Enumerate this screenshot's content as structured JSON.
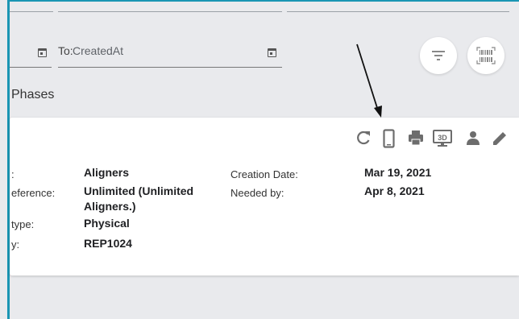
{
  "date_filter": {
    "to_label": "To:",
    "to_value": "CreatedAt"
  },
  "section": {
    "phases_label": "Phases"
  },
  "icons": [
    "calendar-icon",
    "filter-icon",
    "barcode-scan-icon",
    "refresh-icon",
    "mobile-icon",
    "print-icon",
    "3d-view-icon",
    "person-icon",
    "edit-icon",
    "annotation-arrow"
  ],
  "order": {
    "left_labels": [
      ":",
      "eference:",
      "type:",
      "y:"
    ],
    "left_values": {
      "type": "Aligners",
      "reference_line1": "Unlimited (Unlimited",
      "reference_line2": "Aligners.)",
      "form_type": "Physical",
      "by": "REP1024"
    },
    "right_labels": [
      "Creation Date:",
      "Needed by:"
    ],
    "right_values": [
      "Mar 19, 2021",
      "Apr 8, 2021"
    ]
  },
  "colors": {
    "frame": "#1a95b3",
    "background": "#e9eaed",
    "icon": "#6d6d6d"
  }
}
